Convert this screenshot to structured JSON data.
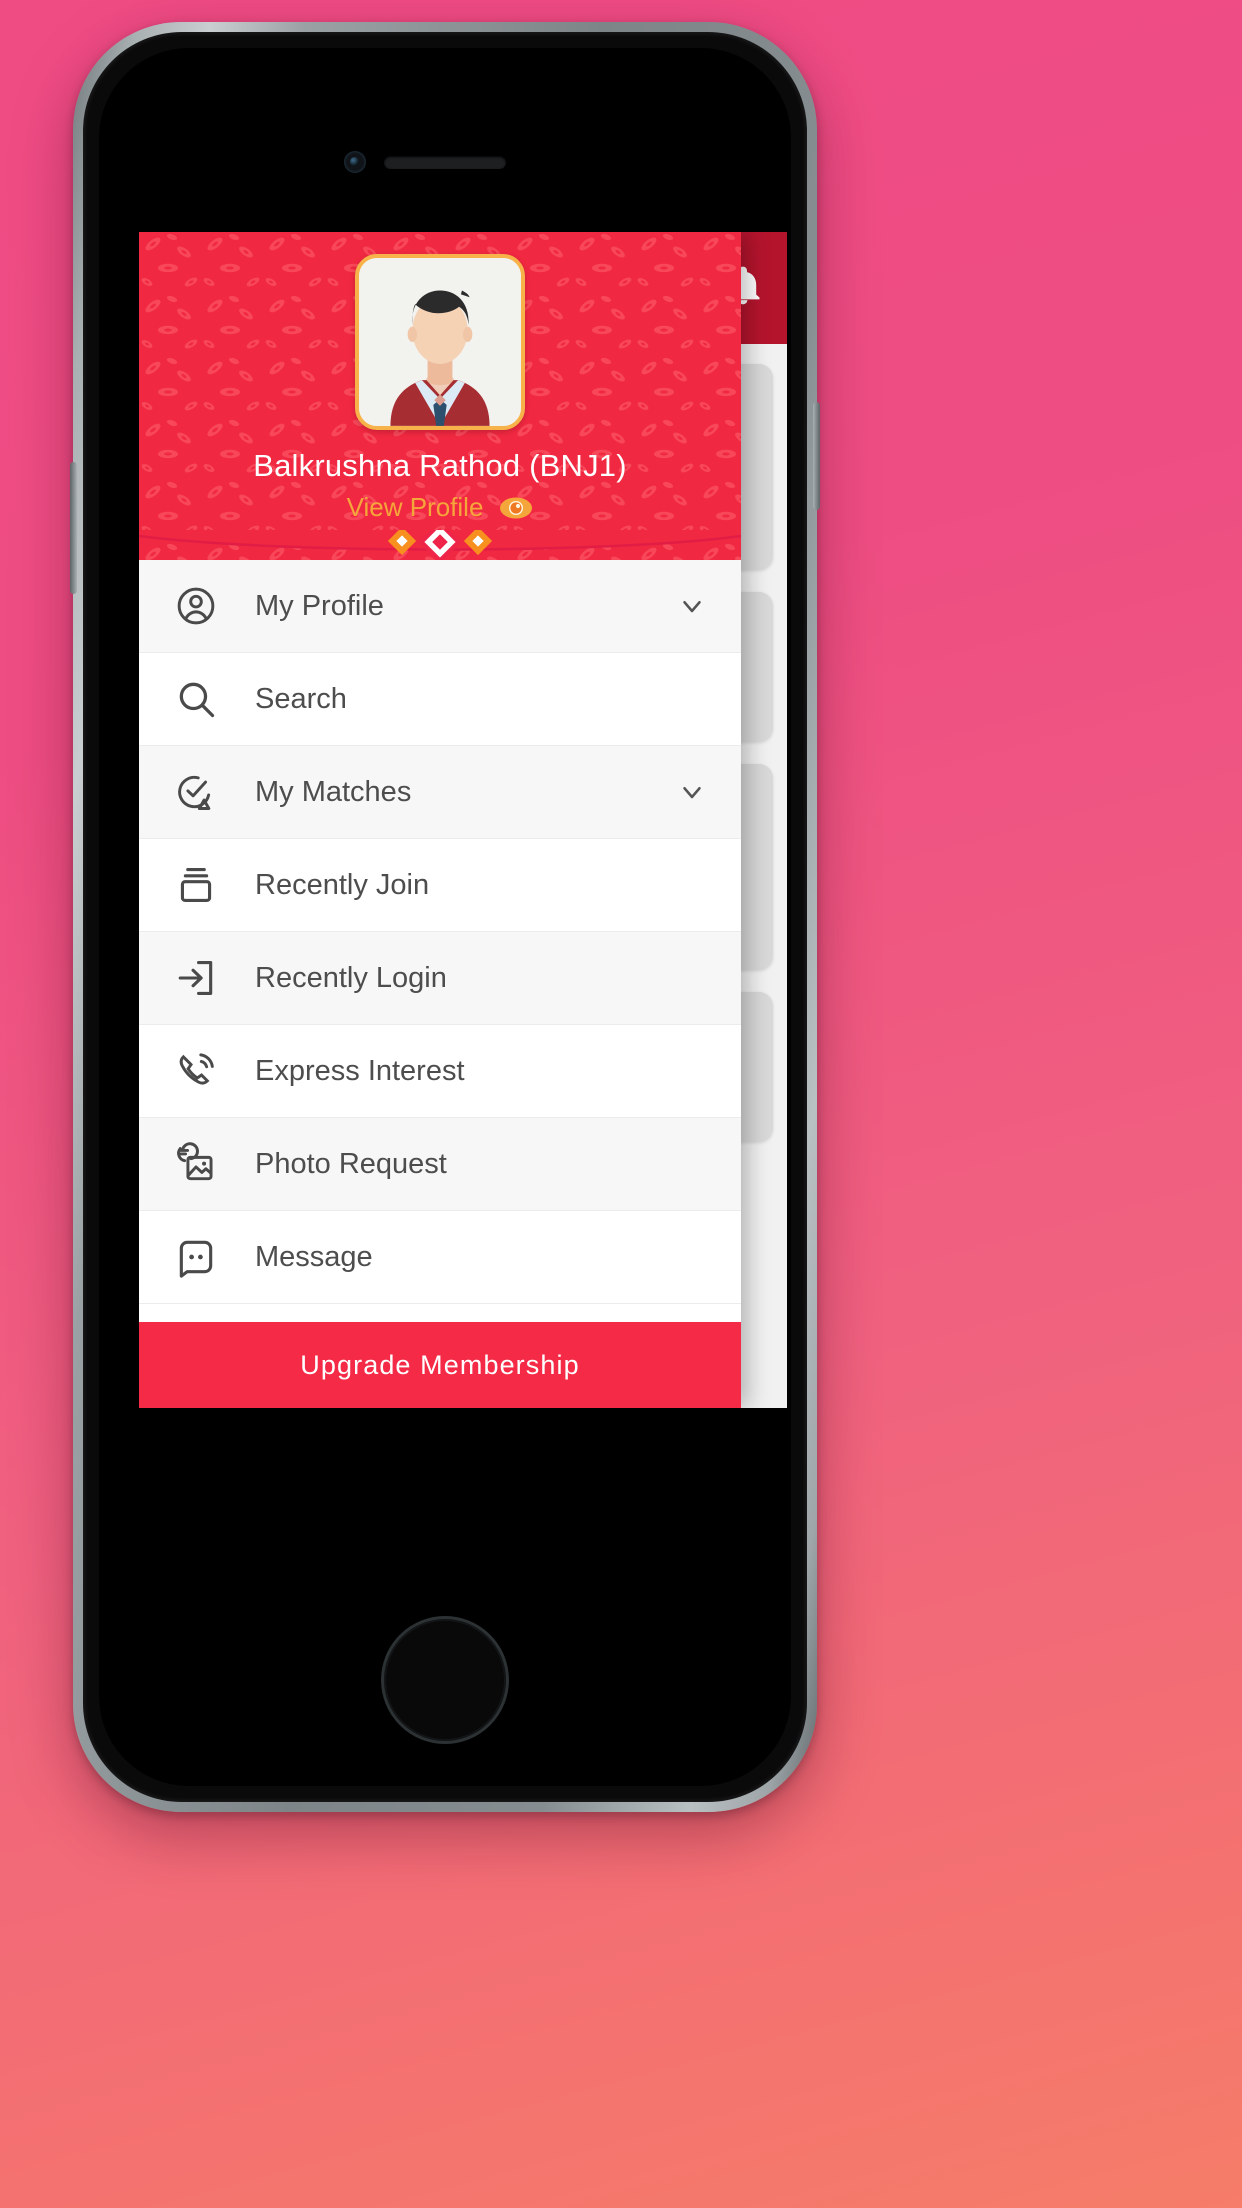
{
  "device": {
    "name": "smartphone-mockup"
  },
  "background_app": {
    "bell_icon": "bell-icon",
    "appbar_color": "#b5142d",
    "cards_count": 4
  },
  "drawer": {
    "header": {
      "background_color": "#f12841",
      "avatar_alt": "user-avatar-photo",
      "avatar_border_color": "#f7b34a",
      "profile_name": "Balkrushna Rathod (BNJ1)",
      "view_profile_label": "View Profile",
      "view_profile_color": "#f5a63a",
      "eye_icon": "eye-icon"
    },
    "menu_items": [
      {
        "label": "My Profile",
        "icon": "account-circle-icon",
        "has_chevron": true,
        "chevron_icon": "chevron-down-icon"
      },
      {
        "label": "Search",
        "icon": "search-icon",
        "has_chevron": false,
        "chevron_icon": ""
      },
      {
        "label": "My Matches",
        "icon": "match-check-icon",
        "has_chevron": true,
        "chevron_icon": "chevron-down-icon"
      },
      {
        "label": "Recently Join",
        "icon": "archive-box-icon",
        "has_chevron": false,
        "chevron_icon": ""
      },
      {
        "label": "Recently Login",
        "icon": "login-arrow-icon",
        "has_chevron": false,
        "chevron_icon": ""
      },
      {
        "label": "Express Interest",
        "icon": "phone-signal-icon",
        "has_chevron": false,
        "chevron_icon": ""
      },
      {
        "label": "Photo Request",
        "icon": "photo-request-icon",
        "has_chevron": false,
        "chevron_icon": ""
      },
      {
        "label": "Message",
        "icon": "chat-bubble-icon",
        "has_chevron": false,
        "chevron_icon": ""
      }
    ],
    "upgrade_button": {
      "label": "Upgrade Membership",
      "background_color": "#f42a47",
      "text_color": "#ffffff"
    }
  },
  "page_background": {
    "gradient_from": "#ef4c84",
    "gradient_to": "#f67d69"
  }
}
